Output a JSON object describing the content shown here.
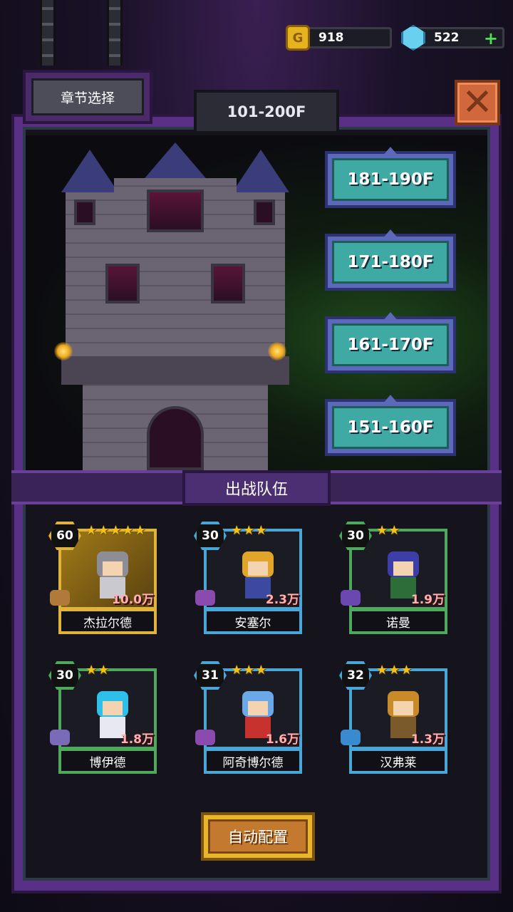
{
  "resources": {
    "gold": {
      "value": "918",
      "icon": "gold-coin-icon",
      "glyph": "G"
    },
    "gems": {
      "value": "522",
      "icon": "gem-icon",
      "plus": "+"
    }
  },
  "header": {
    "chapter_select": "章节选择",
    "floor_range": "101-200F",
    "close_glyph": "✕"
  },
  "floors": [
    {
      "label": "181-190F"
    },
    {
      "label": "171-180F"
    },
    {
      "label": "161-170F"
    },
    {
      "label": "151-160F"
    }
  ],
  "team": {
    "title": "出战队伍",
    "heroes": [
      {
        "name": "杰拉尔德",
        "level": "60",
        "stars": "★★★★★",
        "power": "10.0万",
        "frame": "gold",
        "hair": "#8d8d95",
        "outfit": "#c9c9cf"
      },
      {
        "name": "安塞尔",
        "level": "30",
        "stars": "★★★",
        "power": "2.3万",
        "frame": "blue",
        "hair": "#e0a52a",
        "outfit": "#3b4aa0"
      },
      {
        "name": "诺曼",
        "level": "30",
        "stars": "★★",
        "power": "1.9万",
        "frame": "green",
        "hair": "#3d3ea8",
        "outfit": "#2c6d3a"
      },
      {
        "name": "博伊德",
        "level": "30",
        "stars": "★★",
        "power": "1.8万",
        "frame": "green",
        "hair": "#2ec0e8",
        "outfit": "#e8e8f0"
      },
      {
        "name": "阿奇博尔德",
        "level": "31",
        "stars": "★★★",
        "power": "1.6万",
        "frame": "blue",
        "hair": "#6aa8e8",
        "outfit": "#c8322e"
      },
      {
        "name": "汉弗莱",
        "level": "32",
        "stars": "★★★",
        "power": "1.3万",
        "frame": "blue",
        "hair": "#c98a2a",
        "outfit": "#7a5a2a"
      }
    ]
  },
  "auto_config": "自动配置",
  "colors": {
    "frame_purple": "#5a2f86",
    "floor_teal": "#3fa9a3",
    "gold_star": "#f2c21c"
  }
}
